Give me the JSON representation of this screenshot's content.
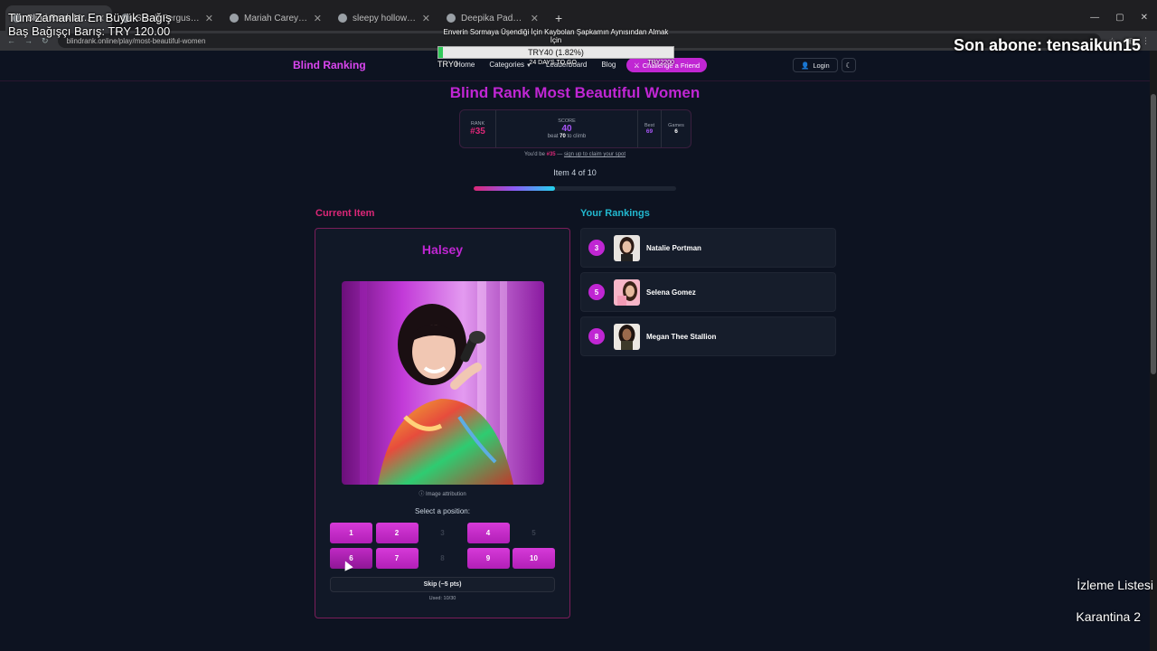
{
  "browser": {
    "tabs": [
      {
        "title": "Blind Rank Most Beautiful Women",
        "active": true
      },
      {
        "title": "Sarah Ferguson - Google'da Ara",
        "active": false
      },
      {
        "title": "Mariah Carey - Google'da Ara",
        "active": false
      },
      {
        "title": "sleepy hollow - Google'da Ara",
        "active": false
      },
      {
        "title": "Deepika Padukone - Google'da",
        "active": false
      }
    ],
    "new_tab": "+",
    "url": "blindrank.online/play/most-beautiful-women"
  },
  "overlay": {
    "top_line1": "Tüm Zamanlar En Büyük Bağış",
    "top_line2": "Baş Bağışçı Barış: TRY 120.00",
    "goal_title": "Enverin Sormaya Üşendiği İçin Kaybolan Şapkamın Aynısından Almak İçin",
    "goal_text": "TRY40 (1.82%)",
    "goal_fraction": 0.0182,
    "goal_start": "TRY0",
    "goal_days": "24 DAYS TO GO",
    "goal_end": "TRY2200",
    "subscriber": "Son abone: tensaikun15",
    "bottom1": "İzleme Listesi",
    "bottom2": "Karantina 2"
  },
  "site": {
    "logo": "Blind Ranking",
    "nav": {
      "home": "Home",
      "categories": "Categories",
      "leaderboard": "Leaderboard",
      "blog": "Blog",
      "challenge": "Challenge a Friend",
      "login": "Login"
    },
    "title": "Blind Rank Most Beautiful Women",
    "stats": {
      "rank_label": "RANK",
      "rank_value": "#35",
      "score_label": "SCORE",
      "score_value": "40",
      "beat_prefix": "beat",
      "beat_value": "70",
      "beat_suffix": "to climb",
      "best_label": "Best",
      "best_value": "69",
      "games_label": "Games",
      "games_value": "6"
    },
    "promo": {
      "prefix": "You'd be",
      "rank": "#35",
      "dash": "—",
      "link": "sign up to claim your spot"
    },
    "item_counter": "Item 4 of 10",
    "progress_fraction": 0.4,
    "current_heading": "Current Item",
    "rankings_heading": "Your Rankings",
    "current_item": {
      "name": "Halsey",
      "attribution": "ⓘ Image attribution"
    },
    "select_label": "Select a position:",
    "positions": [
      {
        "label": "1",
        "used": false
      },
      {
        "label": "2",
        "used": false
      },
      {
        "label": "3",
        "used": true
      },
      {
        "label": "4",
        "used": false
      },
      {
        "label": "5",
        "used": true
      },
      {
        "label": "6",
        "used": false
      },
      {
        "label": "7",
        "used": false
      },
      {
        "label": "8",
        "used": true
      },
      {
        "label": "9",
        "used": false
      },
      {
        "label": "10",
        "used": false
      }
    ],
    "skip_label": "Skip (−5 pts)",
    "used_label": "Used: 10/30",
    "rankings": [
      {
        "rank": "3",
        "name": "Natalie Portman"
      },
      {
        "rank": "5",
        "name": "Selena Gomez"
      },
      {
        "rank": "8",
        "name": "Megan Thee Stallion"
      }
    ]
  },
  "icons": [
    "favicon-icon",
    "close-icon",
    "back-icon",
    "forward-icon",
    "reload-icon",
    "user-icon",
    "moon-icon",
    "swords-icon",
    "info-icon",
    "chevron-down-icon"
  ]
}
